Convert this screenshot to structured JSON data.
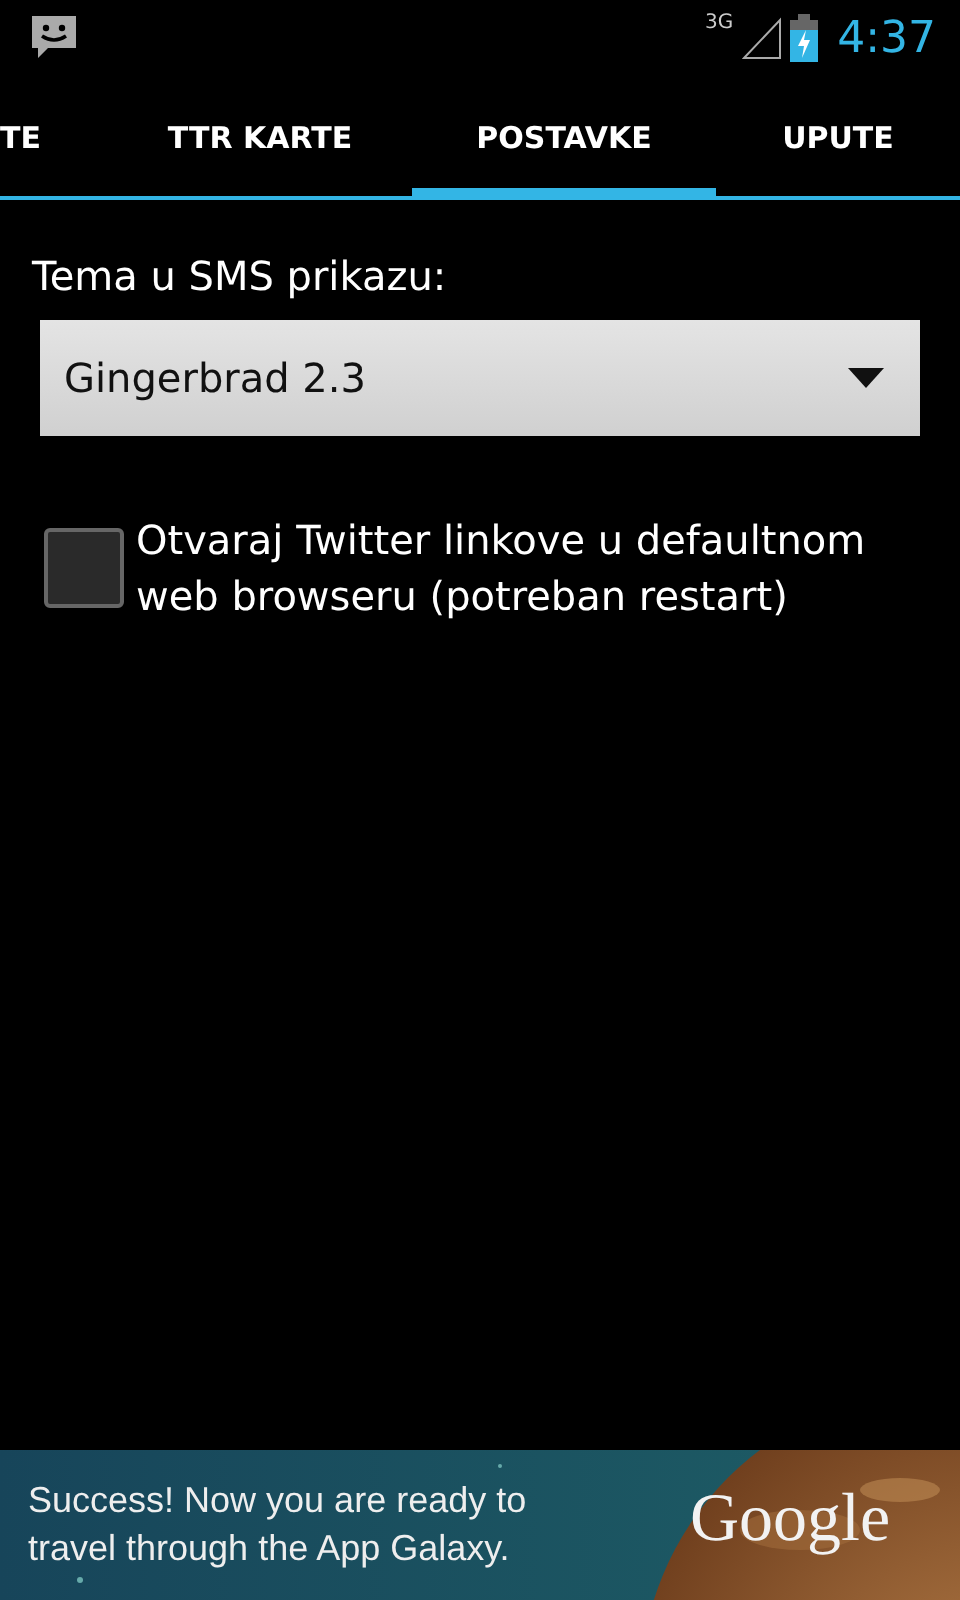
{
  "status_bar": {
    "network": "3G",
    "time": "4:37"
  },
  "tabs": [
    {
      "label": "TE",
      "selected": false
    },
    {
      "label": "TTR KARTE",
      "selected": false
    },
    {
      "label": "POSTAVKE",
      "selected": true
    },
    {
      "label": "UPUTE",
      "selected": false
    }
  ],
  "settings": {
    "theme_label": "Tema u SMS prikazu:",
    "theme_value": "Gingerbrad 2.3",
    "twitter_option": {
      "label": "Otvaraj Twitter linkove u defaultnom web browseru (potreban restart)",
      "checked": false
    }
  },
  "ad": {
    "text": "Success! Now you are ready to travel through the App Galaxy.",
    "logo": "Google"
  }
}
